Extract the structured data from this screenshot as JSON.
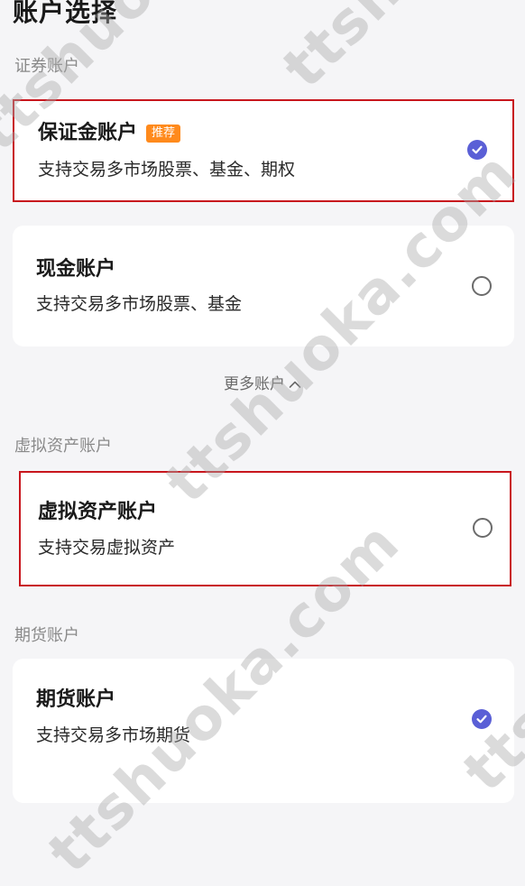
{
  "page": {
    "title": "账户选择"
  },
  "sections": {
    "securities": {
      "label": "证券账户"
    },
    "virtual": {
      "label": "虚拟资产账户"
    },
    "futures": {
      "label": "期货账户"
    }
  },
  "accounts": {
    "margin": {
      "title": "保证金账户",
      "badge": "推荐",
      "desc": "支持交易多市场股票、基金、期权",
      "selected": true
    },
    "cash": {
      "title": "现金账户",
      "desc": "支持交易多市场股票、基金",
      "selected": false
    },
    "virtual": {
      "title": "虚拟资产账户",
      "desc": "支持交易虚拟资产",
      "selected": false
    },
    "futures": {
      "title": "期货账户",
      "desc": "支持交易多市场期货",
      "selected": true
    }
  },
  "more": {
    "label": "更多账户"
  },
  "watermark": {
    "text": "ttshuoka.com"
  },
  "colors": {
    "accent": "#5a5fd6",
    "badge": "#ff8a1c",
    "highlight_border": "#c8161d",
    "background": "#f5f5f7"
  },
  "icons": {
    "selected": "check-circle-icon",
    "unselected": "radio-empty-icon",
    "expand": "chevron-up-icon"
  }
}
